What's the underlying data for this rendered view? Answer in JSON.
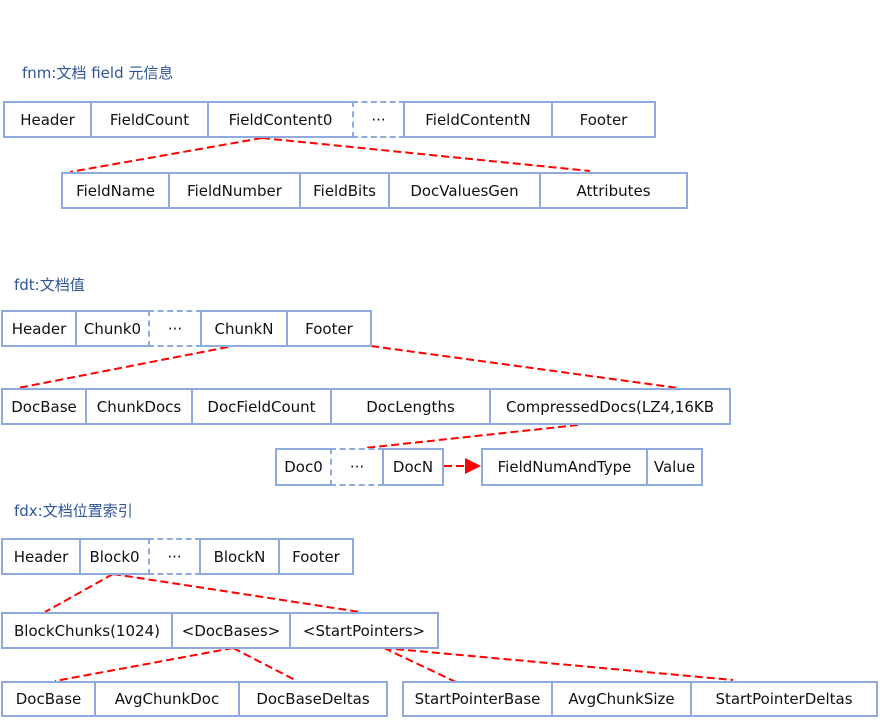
{
  "fnm": {
    "title": "fnm:文档 field 元信息",
    "row1": [
      "Header",
      "FieldCount",
      "FieldContent0",
      "···",
      "FieldContentN",
      "Footer"
    ],
    "row2": [
      "FieldName",
      "FieldNumber",
      "FieldBits",
      "DocValuesGen",
      "Attributes"
    ]
  },
  "fdt": {
    "title": "fdt:文档值",
    "row1": [
      "Header",
      "Chunk0",
      "···",
      "ChunkN",
      "Footer"
    ],
    "row2": [
      "DocBase",
      "ChunkDocs",
      "DocFieldCount",
      "DocLengths",
      "CompressedDocs(LZ4,16KB"
    ],
    "row3": [
      "Doc0",
      "···",
      "DocN"
    ],
    "row4": [
      "FieldNumAndType",
      "Value"
    ]
  },
  "fdx": {
    "title": "fdx:文档位置索引",
    "row1": [
      "Header",
      "Block0",
      "···",
      "BlockN",
      "Footer"
    ],
    "row2": [
      "BlockChunks(1024)",
      "<DocBases>",
      "<StartPointers>"
    ],
    "row3a": [
      "DocBase",
      "AvgChunkDoc",
      "DocBaseDeltas"
    ],
    "row3b": [
      "StartPointerBase",
      "AvgChunkSize",
      "StartPointerDeltas"
    ]
  },
  "colors": {
    "box_border": "#8faadc",
    "link": "#ff0000",
    "title": "#2f5597"
  }
}
